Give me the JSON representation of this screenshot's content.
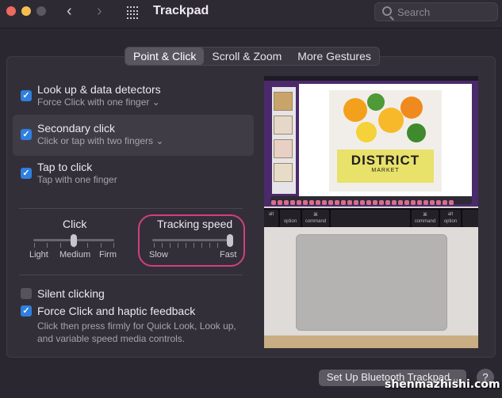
{
  "window": {
    "title": "Trackpad",
    "search_placeholder": "Search"
  },
  "tabs": [
    {
      "label": "Point & Click",
      "active": true
    },
    {
      "label": "Scroll & Zoom",
      "active": false
    },
    {
      "label": "More Gestures",
      "active": false
    }
  ],
  "options": [
    {
      "label": "Look up & data detectors",
      "sub": "Force Click with one finger ⌄",
      "checked": true
    },
    {
      "label": "Secondary click",
      "sub": "Click or tap with two fingers ⌄",
      "checked": true
    },
    {
      "label": "Tap to click",
      "sub": "Tap with one finger",
      "checked": true
    }
  ],
  "click_slider": {
    "title": "Click",
    "labels": [
      "Light",
      "Medium",
      "Firm"
    ],
    "value": "Medium"
  },
  "tracking_slider": {
    "title": "Tracking speed",
    "labels": [
      "Slow",
      "Fast"
    ],
    "value_fraction": 1.0
  },
  "bottom_options": [
    {
      "label": "Silent clicking",
      "checked": false
    },
    {
      "label": "Force Click and haptic feedback",
      "checked": true,
      "sub": "Click then press firmly for Quick Look, Look up,\nand variable speed media controls."
    }
  ],
  "preview": {
    "poster_title": "DISTRICT",
    "poster_subtitle": "MARKET",
    "keys": [
      "alt",
      "⌘",
      "⌘",
      "alt"
    ],
    "key_labels": [
      "option",
      "command",
      "command",
      "option"
    ]
  },
  "buttons": {
    "bluetooth": "Set Up Bluetooth Trackpad...",
    "help": "?"
  },
  "watermark": "shenmazhishi.com",
  "colors": {
    "accent": "#2f7fe0",
    "highlight_ring": "#d33f7e"
  }
}
